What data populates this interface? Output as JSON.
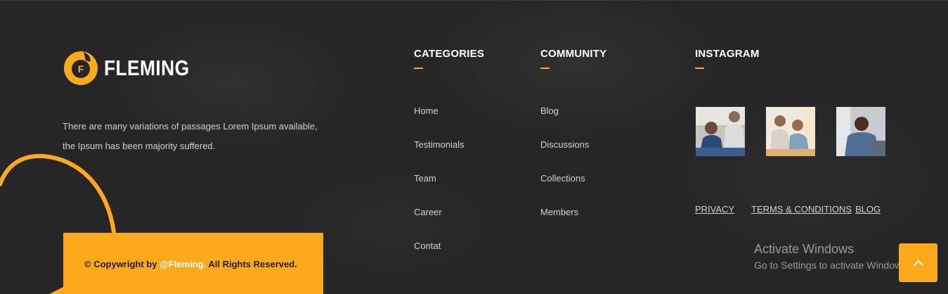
{
  "brand": {
    "logo_letter": "F",
    "name": "FLEMING",
    "accent": "#fcaa1c"
  },
  "about": {
    "text": "There are many variations of passages Lorem Ipsum available, the Ipsum has been majority suffered."
  },
  "copyright": {
    "prefix": "© Copywright by ",
    "highlight": "@Fleming.",
    "suffix": " All Rights Reserved."
  },
  "categories": {
    "title": "CATEGORIES",
    "items": [
      "Home",
      "Testimonials",
      "Team",
      "Career",
      "Contat"
    ]
  },
  "community": {
    "title": "COMMUNITY",
    "items": [
      "Blog",
      "Discussions",
      "Collections",
      "Members"
    ]
  },
  "instagram": {
    "title": "INSTAGRAM",
    "photos": [
      "instagram-photo-meeting",
      "instagram-photo-team",
      "instagram-photo-laughing"
    ]
  },
  "legal": {
    "privacy": "PRIVACY",
    "terms": "TERMS & CONDITIONS",
    "blog": "BLOG"
  },
  "windows": {
    "line1": "Activate Windows",
    "line2": "Go to Settings to activate Windows."
  },
  "back_to_top": {
    "icon": "chevron-up-icon"
  }
}
